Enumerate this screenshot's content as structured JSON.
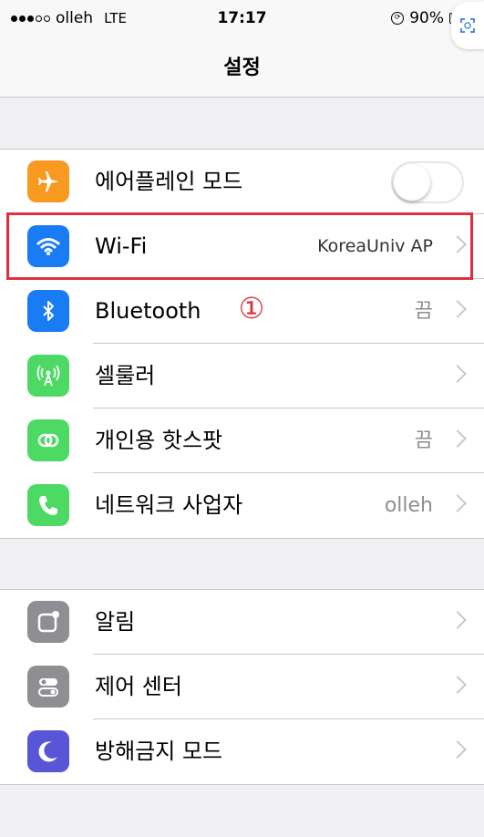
{
  "status_bar": {
    "carrier": "olleh",
    "network": "LTE",
    "time": "17:17",
    "battery": "90%"
  },
  "nav": {
    "title": "설정"
  },
  "groups": [
    {
      "rows": [
        {
          "label": "에어플레인 모드",
          "icon": "airplane-icon",
          "color": "#f79a1f",
          "control": "toggle",
          "toggle_on": false
        },
        {
          "label": "Wi-Fi",
          "icon": "wifi-icon",
          "color": "#1a7cf5",
          "detail": "KoreaUniv AP",
          "control": "chevron"
        },
        {
          "label": "Bluetooth",
          "icon": "bluetooth-icon",
          "color": "#1a7cf5",
          "detail": "끔",
          "control": "chevron"
        },
        {
          "label": "셀룰러",
          "icon": "cellular-icon",
          "color": "#4cd964",
          "detail": "",
          "control": "chevron"
        },
        {
          "label": "개인용 핫스팟",
          "icon": "hotspot-icon",
          "color": "#4cd964",
          "detail": "끔",
          "control": "chevron"
        },
        {
          "label": "네트워크 사업자",
          "icon": "phone-icon",
          "color": "#4cd964",
          "detail": "olleh",
          "control": "chevron"
        }
      ]
    },
    {
      "rows": [
        {
          "label": "알림",
          "icon": "notifications-icon",
          "color": "#8e8e93",
          "detail": "",
          "control": "chevron"
        },
        {
          "label": "제어 센터",
          "icon": "control-center-icon",
          "color": "#8e8e93",
          "detail": "",
          "control": "chevron"
        },
        {
          "label": "방해금지 모드",
          "icon": "moon-icon",
          "color": "#5856d6",
          "detail": "",
          "control": "chevron"
        }
      ]
    }
  ],
  "annotation": {
    "marker": "①",
    "color": "#e03040"
  }
}
